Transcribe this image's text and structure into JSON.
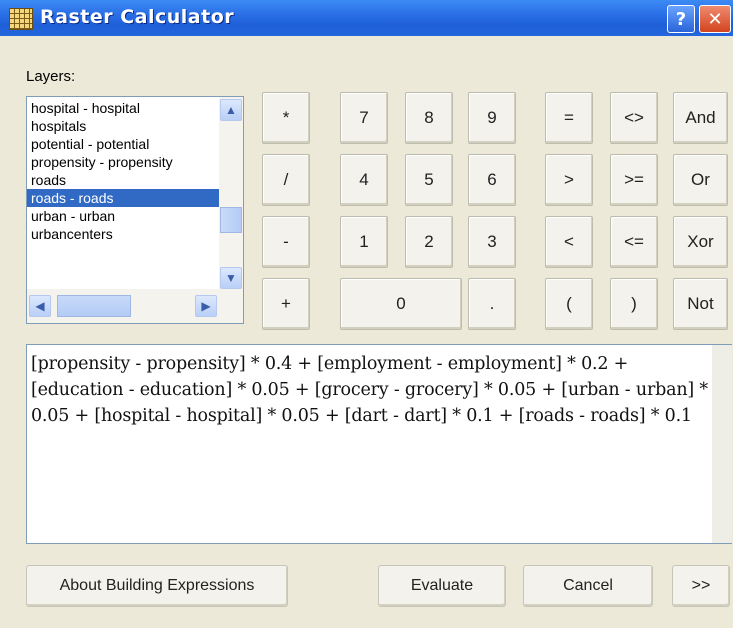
{
  "window": {
    "title": "Raster Calculator"
  },
  "titlebar": {
    "help_label": "?",
    "close_label": "✕"
  },
  "layers": {
    "label": "Layers:",
    "items": [
      "hospital - hospital",
      "hospitals",
      "potential - potential",
      "propensity - propensity",
      "roads",
      "roads - roads",
      "urban - urban",
      "urbancenters"
    ],
    "selected_index": 5
  },
  "keypad": {
    "row1": [
      "*",
      "7",
      "8",
      "9",
      "=",
      "<>",
      "And"
    ],
    "row2": [
      "/",
      "4",
      "5",
      "6",
      ">",
      ">=",
      "Or"
    ],
    "row3": [
      "-",
      "1",
      "2",
      "3",
      "<",
      "<=",
      "Xor"
    ],
    "row4": [
      "+",
      "0",
      ".",
      "(",
      ")",
      "Not"
    ]
  },
  "expression": {
    "value": "[propensity - propensity] * 0.4 + [employment - employment] * 0.2 + [education - education] * 0.05 + [grocery - grocery] * 0.05 + [urban - urban] * 0.05 + [hospital - hospital] * 0.05 + [dart - dart] * 0.1 + [roads - roads] * 0.1"
  },
  "buttons": {
    "about": "About Building Expressions",
    "evaluate": "Evaluate",
    "cancel": "Cancel",
    "more": ">>"
  }
}
